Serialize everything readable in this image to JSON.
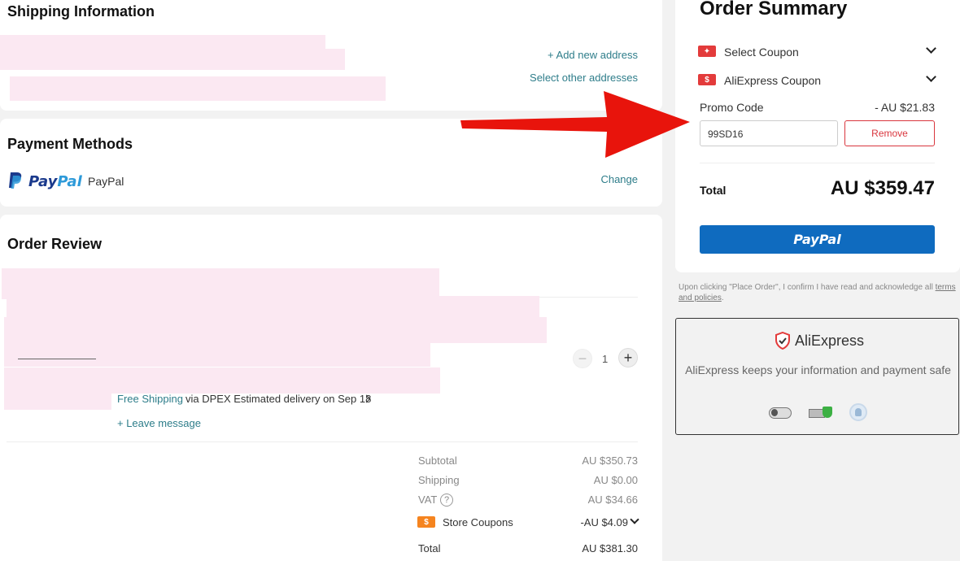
{
  "shipping": {
    "title": "Shipping Information",
    "add_address": "+ Add new address",
    "select_other": "Select other addresses"
  },
  "payment": {
    "title": "Payment Methods",
    "method": "PayPal",
    "logo_text": "PayPal",
    "change": "Change"
  },
  "review": {
    "title": "Order Review",
    "quantity": "1",
    "free_shipping": "Free Shipping",
    "delivery": "via DPEX Estimated delivery on Sep 18",
    "leave_message": "+ Leave message",
    "subtotal_label": "Subtotal",
    "subtotal_value": "AU $350.73",
    "shipping_label": "Shipping",
    "shipping_value": "AU $0.00",
    "vat_label": "VAT",
    "vat_value": "AU $34.66",
    "store_coupons_label": "Store Coupons",
    "store_coupons_value": "-AU $4.09",
    "total_label": "Total",
    "total_value": "AU $381.30"
  },
  "summary": {
    "title": "Order Summary",
    "select_coupon": "Select Coupon",
    "aliexpress_coupon": "AliExpress Coupon",
    "promo_label": "Promo Code",
    "promo_discount": "- AU $21.83",
    "promo_value": "99SD16",
    "remove": "Remove",
    "total_label": "Total",
    "total_value": "AU $359.47",
    "paypal_button": "PayPal",
    "agreement_text": "Upon clicking \"Place Order\", I confirm I have read and acknowledge all",
    "terms_link": "terms and policies",
    "terms_period": "."
  },
  "security": {
    "brand": "AliExpress",
    "message": "AliExpress keeps your information and payment safe"
  },
  "colors": {
    "accent_teal": "#2e7d8a",
    "remove_red": "#d9363e",
    "paypal_blue": "#0f6bbf",
    "coupon_red": "#e33b3b",
    "store_orange": "#f5841f",
    "arrow_red": "#e8140c"
  }
}
